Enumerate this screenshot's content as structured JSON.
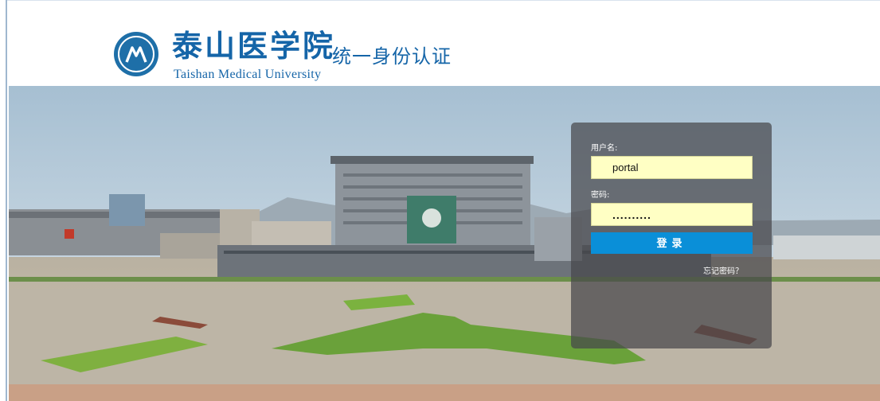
{
  "header": {
    "brand_cn": "泰山医学院",
    "brand_en": "Taishan Medical University",
    "system_title": "统一身份认证"
  },
  "login": {
    "username_label": "用户名:",
    "username_value": "portal",
    "password_label": "密码:",
    "password_value": "..........",
    "submit_label": "登录",
    "forgot_label": "忘记密码？"
  },
  "colors": {
    "brand_blue": "#1565a8",
    "field_bg": "#ffffc4",
    "button_bg": "#0a8fd8",
    "panel_bg": "rgba(70,70,75,0.72)"
  },
  "icons": {
    "logo": "university-emblem-icon"
  }
}
